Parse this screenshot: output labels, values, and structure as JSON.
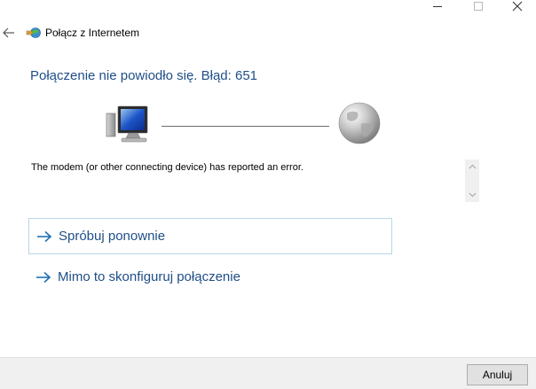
{
  "window": {
    "controls": {
      "minimize_icon": "minimize-icon",
      "maximize_icon": "maximize-icon",
      "close_icon": "close-icon"
    }
  },
  "header": {
    "back_icon": "back-arrow-icon",
    "app_icon": "network-connection-icon",
    "title": "Połącz z Internetem"
  },
  "status": {
    "heading": "Połączenie nie powiodło się. Błąd: 651",
    "computer_icon": "computer-icon",
    "globe_icon": "globe-icon",
    "error_message": "The modem (or other connecting device) has reported an error."
  },
  "actions": {
    "retry_label": "Spróbuj ponownie",
    "setup_anyway_label": "Mimo to skonfiguruj połączenie",
    "arrow_icon": "arrow-right-icon"
  },
  "footer": {
    "cancel_label": "Anuluj"
  },
  "colors": {
    "heading_blue": "#1f4e87",
    "link_blue": "#1f4e87",
    "focus_border": "#b9d6e8",
    "footer_bg": "#f0f0f0"
  }
}
